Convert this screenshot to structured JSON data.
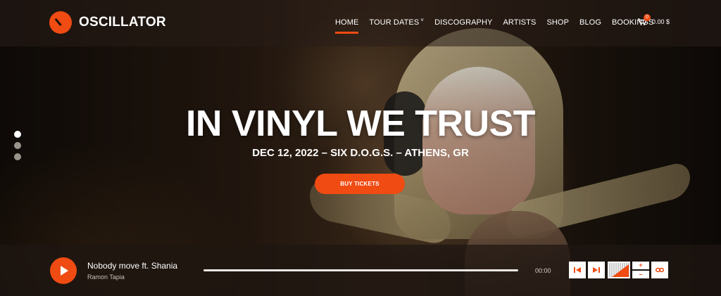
{
  "brand": {
    "name": "OSCILLATOR",
    "accent": "#ef4b12"
  },
  "nav": {
    "items": [
      {
        "label": "HOME",
        "active": true
      },
      {
        "label": "TOUR DATES",
        "dropdown": true
      },
      {
        "label": "DISCOGRAPHY"
      },
      {
        "label": "ARTISTS"
      },
      {
        "label": "SHOP"
      },
      {
        "label": "BLOG"
      },
      {
        "label": "BOOKINGS"
      }
    ],
    "dropdown_caret": "˅"
  },
  "cart": {
    "count": "0",
    "total": "0.00 $",
    "icon": "cart-icon"
  },
  "slider": {
    "slide_count": 3,
    "active_index": 0
  },
  "hero": {
    "title": "IN VINYL WE TRUST",
    "subtitle": "DEC 12, 2022 – SIX D.O.G.S. – ATHENS, GR",
    "cta_label": "BUY TICKETS"
  },
  "player": {
    "track_title": "Nobody move ft. Shania",
    "artist": "Ramon Tapia",
    "time": "00:00",
    "volume_plus": "+",
    "volume_minus": "–",
    "icons": {
      "play": "play-icon",
      "previous": "skip-back-icon",
      "next": "skip-forward-icon",
      "volume": "volume-meter-icon",
      "loop": "loop-icon"
    }
  }
}
